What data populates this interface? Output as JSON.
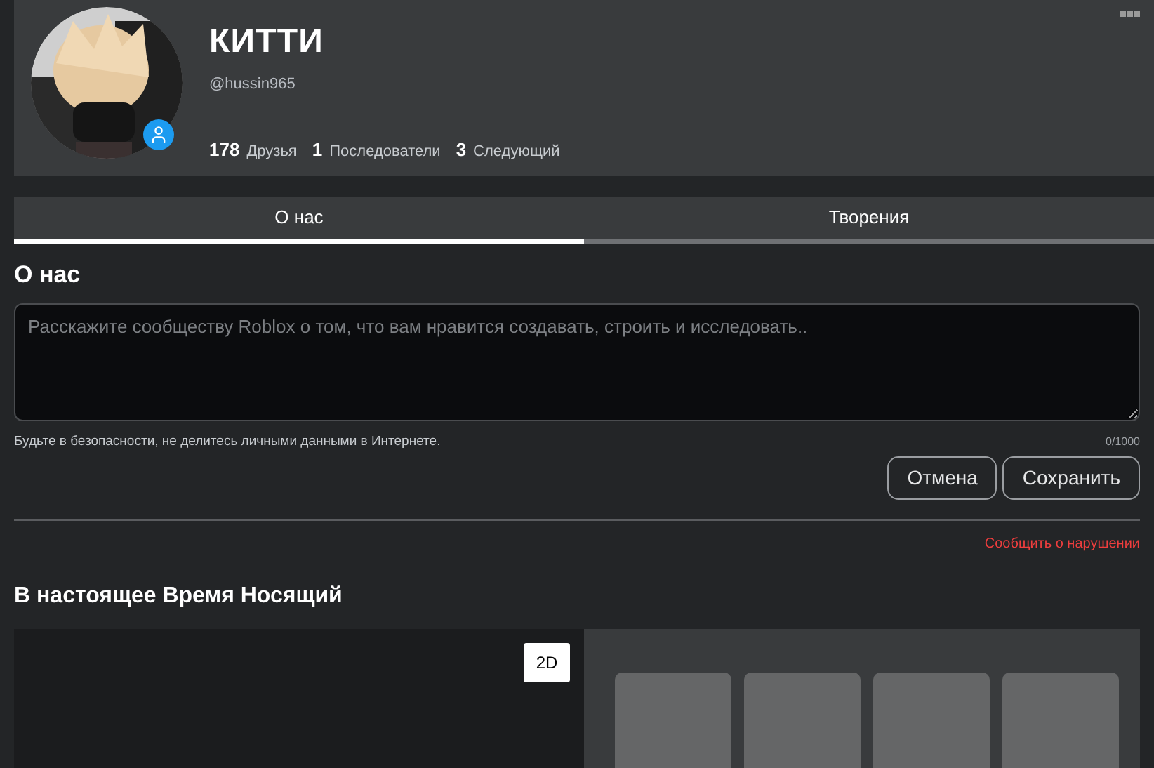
{
  "profile": {
    "display_name": "КИТТИ",
    "username": "@hussin965",
    "stats": [
      {
        "count": "178",
        "label": "Друзья"
      },
      {
        "count": "1",
        "label": "Последователи"
      },
      {
        "count": "3",
        "label": "Следующий"
      }
    ]
  },
  "tabs": [
    {
      "label": "О нас",
      "selected": true
    },
    {
      "label": "Творения",
      "selected": false
    }
  ],
  "about": {
    "heading": "О нас",
    "placeholder": "Расскажите сообществу Roblox о том, что вам нравится создавать, строить и исследовать..",
    "hint": "Будьте в безопасности, не делитесь личными данными в Интернете.",
    "counter": "0/1000",
    "buttons": [
      "Отмена",
      "Сохранить"
    ],
    "report_link": "Сообщить о нарушении"
  },
  "wearing": {
    "heading": "В настоящее Время Носящий",
    "view_toggle": "2D",
    "items": [
      {
        "kind": "empty"
      },
      {
        "kind": "empty"
      },
      {
        "kind": "empty"
      },
      {
        "kind": "empty"
      }
    ]
  }
}
